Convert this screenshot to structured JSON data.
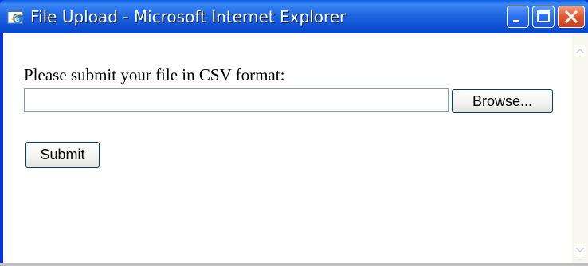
{
  "window": {
    "title": "File Upload - Microsoft Internet Explorer"
  },
  "form": {
    "prompt": "Please submit your file in CSV format:",
    "file_value": "",
    "browse_label": "Browse...",
    "submit_label": "Submit"
  },
  "icons": [
    "ie-app-icon",
    "minimize-icon",
    "maximize-icon",
    "close-icon",
    "scroll-up-arrow-icon",
    "scroll-down-arrow-icon"
  ],
  "colors": {
    "titlebar": "#0a5ee8",
    "close_button": "#e35b32",
    "input_border": "#7f9db9",
    "button_border": "#003c74"
  }
}
